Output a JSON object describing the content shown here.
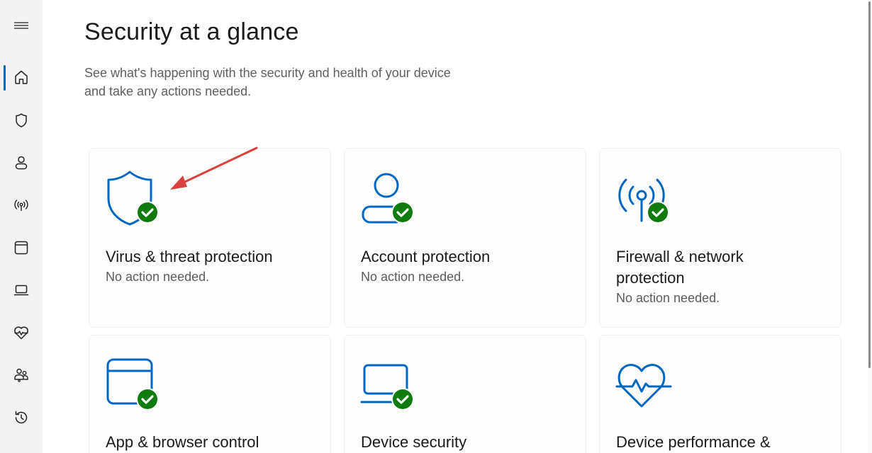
{
  "nav": {
    "items": [
      {
        "name": "home",
        "icon": "home-icon"
      },
      {
        "name": "virus-threat",
        "icon": "shield-icon"
      },
      {
        "name": "account",
        "icon": "person-icon"
      },
      {
        "name": "firewall",
        "icon": "antenna-icon"
      },
      {
        "name": "app-browser",
        "icon": "browser-window-icon"
      },
      {
        "name": "device-security",
        "icon": "laptop-icon"
      },
      {
        "name": "device-performance",
        "icon": "heart-pulse-icon"
      },
      {
        "name": "family",
        "icon": "family-icon"
      },
      {
        "name": "history",
        "icon": "history-icon"
      }
    ],
    "accent": "#0067c0"
  },
  "header": {
    "title": "Security at a glance",
    "subtitle_line1": "See what's happening with the security and health of your device",
    "subtitle_line2": "and take any actions needed."
  },
  "cards": [
    {
      "title": "Virus & threat protection",
      "status": "No action needed.",
      "icon": "shield-check-icon"
    },
    {
      "title": "Account protection",
      "status": "No action needed.",
      "icon": "person-check-icon"
    },
    {
      "title": "Firewall & network protection",
      "title_line1": "Firewall & network",
      "title_line2": "protection",
      "status": "No action needed.",
      "icon": "antenna-check-icon"
    },
    {
      "title": "App & browser control",
      "icon": "browser-check-icon"
    },
    {
      "title": "Device security",
      "icon": "laptop-check-icon"
    },
    {
      "title": "Device performance &",
      "icon": "heart-pulse-icon"
    }
  ],
  "colors": {
    "icon_blue": "#0067c0",
    "check_green": "#107c10",
    "annotation_red": "#d9413d"
  }
}
